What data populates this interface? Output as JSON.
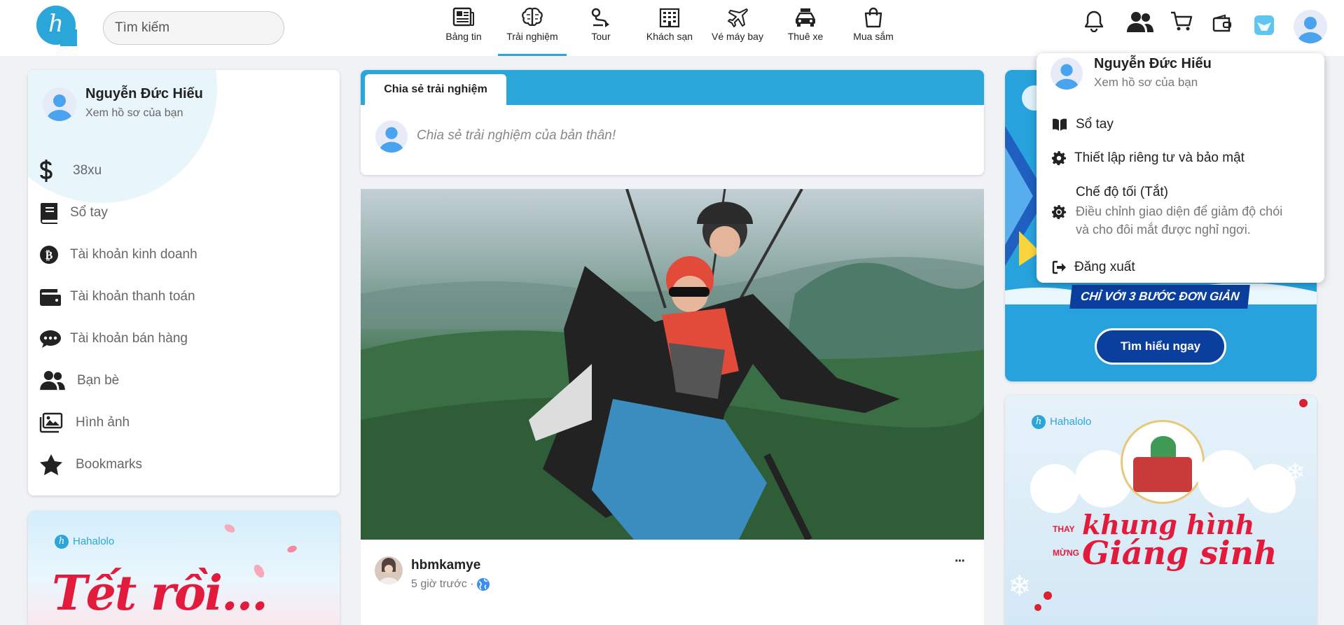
{
  "header": {
    "logo_letter": "h",
    "search_placeholder": "Tìm kiếm",
    "nav": [
      {
        "label": "Bảng tin",
        "icon": "newspaper-icon"
      },
      {
        "label": "Trải nghiệm",
        "icon": "brain-icon",
        "active": true
      },
      {
        "label": "Tour",
        "icon": "route-icon"
      },
      {
        "label": "Khách sạn",
        "icon": "building-icon"
      },
      {
        "label": "Vé máy bay",
        "icon": "plane-icon"
      },
      {
        "label": "Thuê xe",
        "icon": "car-icon"
      },
      {
        "label": "Mua sắm",
        "icon": "shopping-bag-icon"
      }
    ],
    "right_icons": [
      "bell-icon",
      "friends-icon",
      "cart-icon",
      "wallet-icon",
      "app-icon",
      "avatar"
    ]
  },
  "left_sidebar": {
    "user_name": "Nguyễn Đức Hiếu",
    "profile_link": "Xem hồ sơ của bạn",
    "items": [
      {
        "label": "38xu",
        "icon": "dollar-icon"
      },
      {
        "label": "Sổ tay",
        "icon": "book-icon"
      },
      {
        "label": "Tài khoản kinh doanh",
        "icon": "bitcoin-icon"
      },
      {
        "label": "Tài khoản thanh toán",
        "icon": "wallet-icon"
      },
      {
        "label": "Tài khoản bán hàng",
        "icon": "chat-icon"
      },
      {
        "label": "Bạn bè",
        "icon": "friends-icon"
      },
      {
        "label": "Hình ảnh",
        "icon": "images-icon"
      },
      {
        "label": "Bookmarks",
        "icon": "star-icon"
      }
    ],
    "banner": {
      "brand": "Hahalolo",
      "headline": "Tết rồi..."
    }
  },
  "composer": {
    "tab_label": "Chia sẻ trải nghiệm",
    "placeholder": "Chia sẻ trải nghiệm của bản thân!"
  },
  "post": {
    "author": "hbmkamye",
    "time": "5 giờ trước ·",
    "more": "···"
  },
  "right_column": {
    "banner1": {
      "subhead": "CHỈ VỚI 3 BƯỚC ĐƠN GIẢN",
      "cta": "Tìm hiểu ngay"
    },
    "banner2": {
      "brand": "Hahalolo",
      "line_small_1": "THAY",
      "line_big_1": "khung hình",
      "line_small_2": "MỪNG",
      "line_big_2": "Giáng sinh"
    }
  },
  "dropdown": {
    "user_name": "Nguyễn Đức Hiếu",
    "profile_link": "Xem hồ sơ của bạn",
    "notebook": "Sổ tay",
    "privacy": "Thiết lập riêng tư và bảo mật",
    "dark_mode_title": "Chế độ tối (Tắt)",
    "dark_mode_desc_1": "Điều chỉnh giao diện để giảm độ chói",
    "dark_mode_desc_2": "và cho đôi mắt được nghỉ ngơi.",
    "logout": "Đăng xuất"
  },
  "colors": {
    "brand": "#2aa6d9",
    "accent_red": "#e21b3c",
    "cta_blue": "#0b3f9e"
  }
}
